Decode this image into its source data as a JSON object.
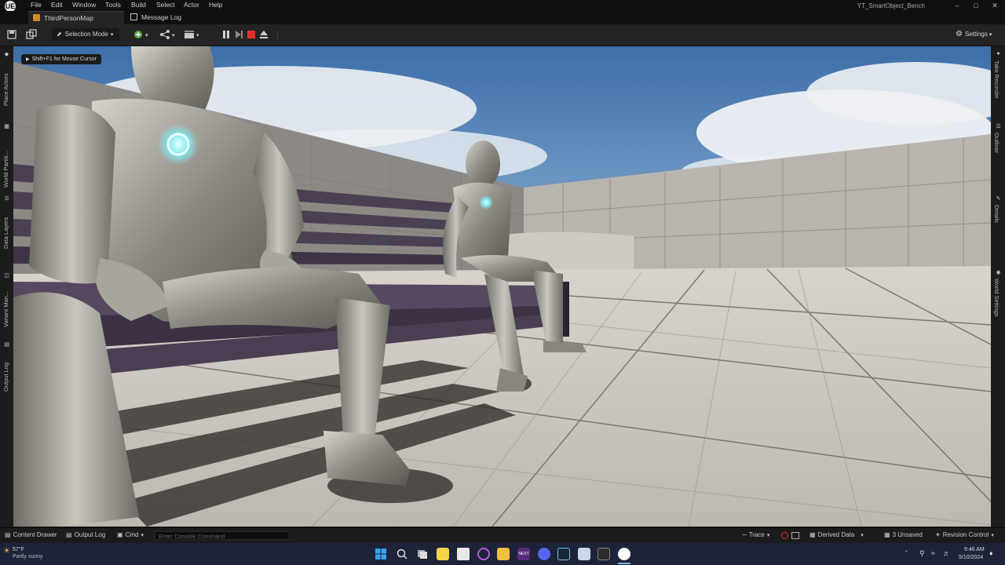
{
  "menubar": {
    "items": [
      "File",
      "Edit",
      "Window",
      "Tools",
      "Build",
      "Select",
      "Actor",
      "Help"
    ],
    "project_name": "YT_SmartObject_Bench",
    "logo": "UE"
  },
  "tabs": [
    {
      "label": "ThirdPersonMap",
      "icon": "map-icon"
    },
    {
      "label": "Message Log",
      "icon": "log-icon"
    }
  ],
  "toolbar": {
    "selection_mode": "Selection Mode",
    "settings": "Settings"
  },
  "left_panel": [
    "Place Actors",
    "World Partiti...",
    "Data Layers",
    "Variant Man...",
    "Output Log"
  ],
  "right_panel": [
    "Take Recorder",
    "Outliner",
    "Details",
    "World Settings"
  ],
  "viewport": {
    "hint": "Shift+F1 for Mouse Cursor"
  },
  "statusbar": {
    "content_drawer": "Content Drawer",
    "output_log": "Output Log",
    "cmd": "Cmd",
    "console_placeholder": "Enter Console Command",
    "trace": "Trace",
    "derived_data": "Derived Data",
    "unsaved": "3 Unsaved",
    "revision_control": "Revision Control"
  },
  "taskbar": {
    "weather_temp": "57°F",
    "weather_desc": "Partly sunny",
    "time": "9:46 AM",
    "date": "5/10/2024"
  },
  "colors": {
    "accent_red": "#e03030",
    "panel": "#242424",
    "taskbar": "#1d2338"
  }
}
